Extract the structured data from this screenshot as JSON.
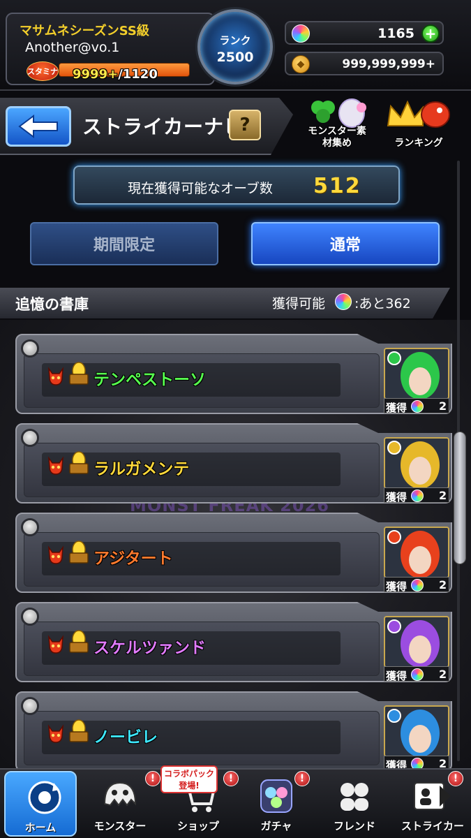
{
  "player": {
    "title": "マサムネシーズンSS級",
    "name": "Another@vo.1",
    "stamina_badge": "スタミナ",
    "stamina_current": "9999+",
    "stamina_max": "/1120"
  },
  "rank": {
    "label": "ランク",
    "value": "2500"
  },
  "currency": {
    "orbs": "1165",
    "coins": "999,999,999+",
    "add_symbol": "+"
  },
  "navi": {
    "title": "ストライカーナビ",
    "help": "?"
  },
  "shortcuts": {
    "monster_collect": "モンスター素材集め",
    "ranking": "ランキング"
  },
  "orb_counter": {
    "label": "現在獲得可能なオーブ数",
    "value": "512"
  },
  "tabs": {
    "limited": "期間限定",
    "normal": "通常"
  },
  "section": {
    "title": "追憶の書庫",
    "obtainable": "獲得可能",
    "remaining": ":あと362"
  },
  "watermark": "MONST FREAK 2026",
  "earn_label": "獲得",
  "quests": [
    {
      "name": "テンペストーソ",
      "color": "#57ff4f",
      "element": "#2cc74a",
      "count": "2"
    },
    {
      "name": "ラルガメンテ",
      "color": "#ffd93b",
      "element": "#e6b82a",
      "count": "2"
    },
    {
      "name": "アジタート",
      "color": "#ff7a2e",
      "element": "#e8411d",
      "count": "2"
    },
    {
      "name": "スケルツァンド",
      "color": "#e27bff",
      "element": "#9b4de0",
      "count": "2"
    },
    {
      "name": "ノービレ",
      "color": "#3ee8ff",
      "element": "#2d8ee0",
      "count": "2"
    }
  ],
  "nav": {
    "home": "ホーム",
    "monster": "モンスター",
    "shop": "ショップ",
    "gacha": "ガチャ",
    "friend": "フレンド",
    "striker": "ストライカー",
    "collab_tag": "コラボパック登場!",
    "alert": "!"
  }
}
